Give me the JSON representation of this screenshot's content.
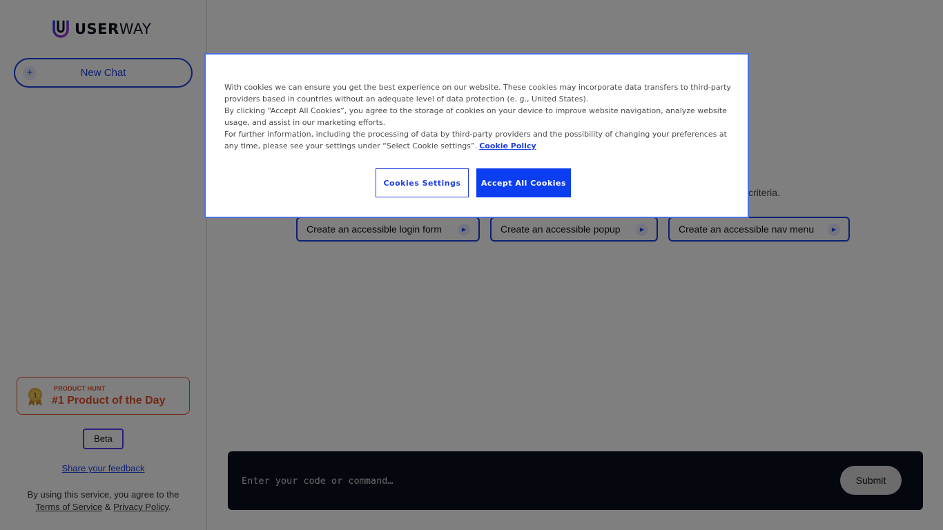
{
  "sidebar": {
    "logo_text_bold": "USER",
    "logo_text_regular": "WAY",
    "new_chat_label": "New Chat",
    "product_hunt": {
      "small_label": "PRODUCT HUNT",
      "title": "#1 Product of the Day",
      "medal_number": "1"
    },
    "beta_label": "Beta",
    "feedback_link": "Share your feedback",
    "terms": {
      "prefix": "By using this service, you agree to the",
      "terms_link": "Terms of Service",
      "joiner": "&",
      "privacy_link": "Privacy Policy",
      "suffix": "."
    }
  },
  "main": {
    "partial_subtext": "criteria.",
    "suggestions": [
      {
        "label": "Create an accessible login form"
      },
      {
        "label": "Create an accessible popup"
      },
      {
        "label": "Create an accessible nav menu"
      }
    ],
    "input": {
      "placeholder": "Enter your code or command…",
      "value": ""
    },
    "submit_label": "Submit"
  },
  "cookie_modal": {
    "paragraphs": [
      "With cookies we can ensure you get the best experience on our website. These cookies may incorporate data transfers to third-party providers based in countries without an adequate level of data protection (e. g., United States).",
      "By clicking “Accept All Cookies”, you agree to the storage of cookies on your device to improve website navigation, analyze website usage, and assist in our marketing efforts.",
      "For further information, including the processing of data by third-party providers and the possibility of changing your preferences at any time, please see your settings under “Select Cookie settings”."
    ],
    "policy_link": "Cookie Policy",
    "settings_button": "Cookies Settings",
    "accept_button": "Accept All Cookies"
  },
  "colors": {
    "brand_blue": "#1f3ee0",
    "accept_blue": "#0b3ef0",
    "product_hunt_orange": "#e4502a",
    "input_bg": "#0b0f1f"
  }
}
